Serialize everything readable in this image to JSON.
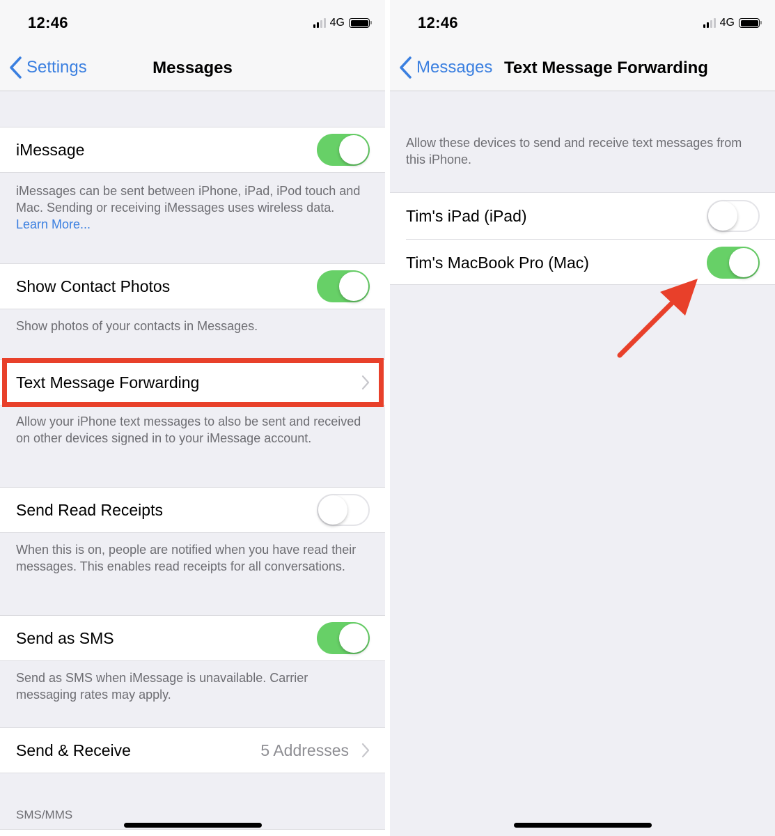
{
  "colors": {
    "accent": "#3a7fe0",
    "toggle_on": "#67d067",
    "highlight": "#e8402a"
  },
  "left": {
    "status": {
      "time": "12:46",
      "network": "4G"
    },
    "nav": {
      "back_label": "Settings",
      "title": "Messages"
    },
    "imessage": {
      "label": "iMessage",
      "enabled": true,
      "footer_text": "iMessages can be sent between iPhone, iPad, iPod touch and Mac. Sending or receiving iMessages uses wireless data. ",
      "footer_link": "Learn More..."
    },
    "contact_photos": {
      "label": "Show Contact Photos",
      "enabled": true,
      "footer_text": "Show photos of your contacts in Messages."
    },
    "text_forwarding": {
      "label": "Text Message Forwarding",
      "footer_text": "Allow your iPhone text messages to also be sent and received on other devices signed in to your iMessage account."
    },
    "read_receipts": {
      "label": "Send Read Receipts",
      "enabled": false,
      "footer_text": "When this is on, people are notified when you have read their messages. This enables read receipts for all conversations."
    },
    "send_sms": {
      "label": "Send as SMS",
      "enabled": true,
      "footer_text": "Send as SMS when iMessage is unavailable. Carrier messaging rates may apply."
    },
    "send_receive": {
      "label": "Send & Receive",
      "value": "5 Addresses"
    },
    "sms_mms_header": "SMS/MMS"
  },
  "right": {
    "status": {
      "time": "12:46",
      "network": "4G"
    },
    "nav": {
      "back_label": "Messages",
      "title": "Text Message Forwarding"
    },
    "description": "Allow these devices to send and receive text messages from this iPhone.",
    "devices": [
      {
        "label": "Tim's iPad (iPad)",
        "enabled": false
      },
      {
        "label": "Tim's MacBook Pro (Mac)",
        "enabled": true
      }
    ]
  },
  "icons": {
    "back": "chevron-left-icon",
    "disclosure": "chevron-right-icon",
    "signal": "cellular-signal-icon",
    "battery": "battery-icon",
    "annotation_arrow": "red-arrow-icon"
  }
}
